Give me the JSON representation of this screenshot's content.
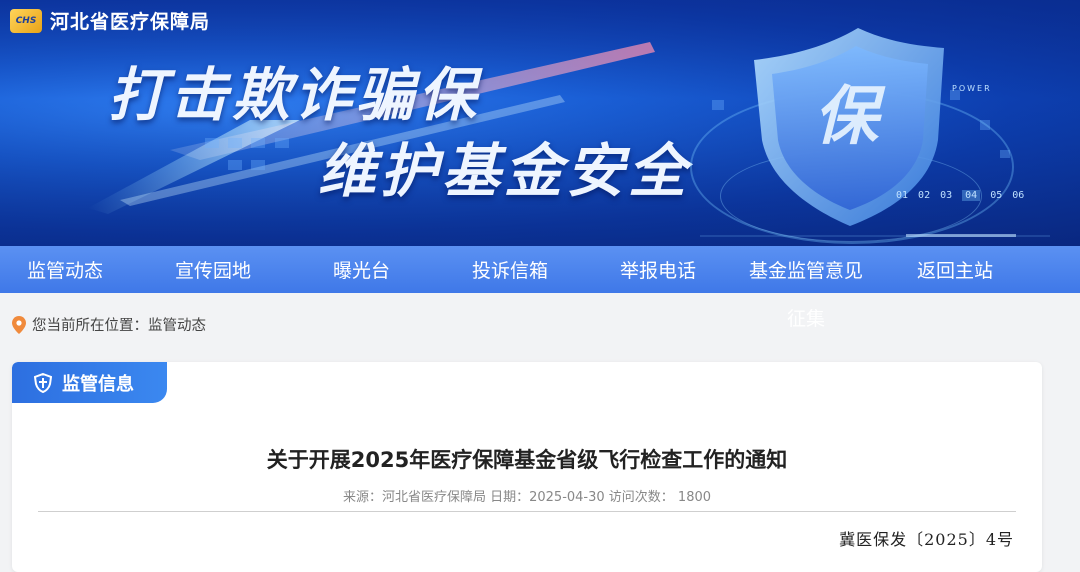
{
  "header": {
    "logo_badge": "CHS",
    "site_title": "河北省医疗保障局",
    "slogan_line1": "打击欺诈骗保",
    "slogan_line2": "维护基金安全",
    "shield_char": "保",
    "shield_small_text": "POWER",
    "number_strip": [
      "01",
      "02",
      "03",
      "04",
      "05",
      "06"
    ]
  },
  "nav": {
    "items": [
      {
        "label": "监管动态"
      },
      {
        "label": "宣传园地"
      },
      {
        "label": "曝光台"
      },
      {
        "label": "投诉信箱"
      },
      {
        "label": "举报电话"
      },
      {
        "label": "基金监管意见"
      },
      {
        "label": "返回主站"
      }
    ],
    "item6_overflow": "征集"
  },
  "breadcrumb": {
    "prefix": "您当前所在位置：",
    "current": "监管动态"
  },
  "section": {
    "tab_label": "监管信息"
  },
  "article": {
    "title": "关于开展2025年医疗保障基金省级飞行检查工作的通知",
    "meta": "来源：河北省医疗保障局 日期：2025-04-30 访问次数： 1800",
    "doc_number": "冀医保发〔2025〕4号"
  },
  "colors": {
    "nav_bg": "#4a84ec",
    "banner_bg": "#1a5fd6",
    "tab_bg": "#2d6fe0",
    "pin": "#f08a3c"
  }
}
